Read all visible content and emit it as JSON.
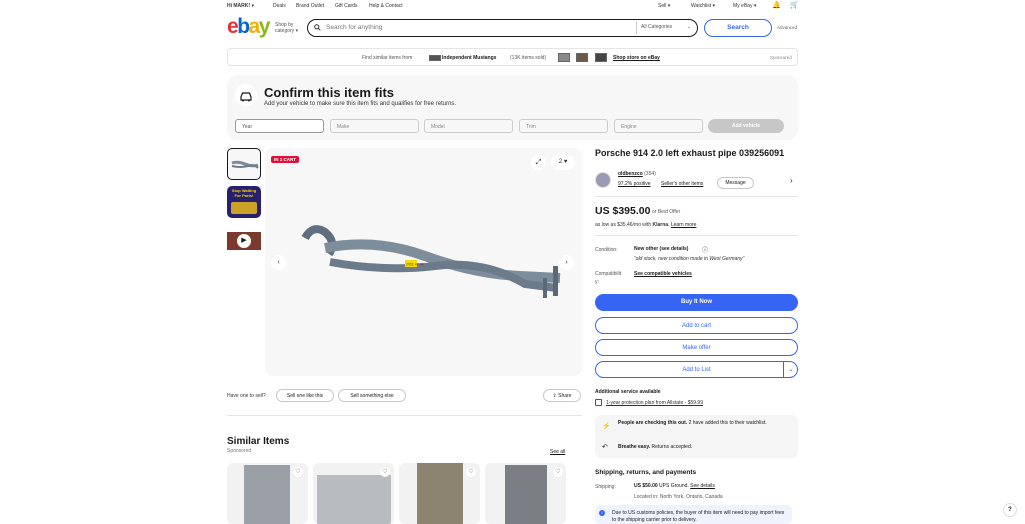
{
  "topbar": {
    "greeting": "Hi MARK!",
    "links": [
      "Deals",
      "Brand Outlet",
      "Gift Cards",
      "Help & Contact"
    ],
    "sell": "Sell",
    "watchlist": "Watchlist",
    "my_ebay": "My eBay"
  },
  "header": {
    "logo": [
      "e",
      "b",
      "a",
      "y"
    ],
    "shop_by": "Shop by",
    "category": "category",
    "search_placeholder": "Search for anything",
    "category_select": "All Categories",
    "search_button": "Search",
    "advanced": "Advanced"
  },
  "banner": {
    "prefix": "Find similar items from",
    "store": "Independent Mustangs",
    "sold": "(13K items sold)",
    "shop_link": "Shop store on eBay",
    "sponsored": "Sponsored"
  },
  "fitment": {
    "title": "Confirm this item fits",
    "subtitle": "Add your vehicle to make sure this item fits and qualifies for free returns.",
    "fields": [
      "Year",
      "Make",
      "Model",
      "Trim",
      "Engine"
    ],
    "button": "Add vehicle"
  },
  "gallery": {
    "badge": "IN 1 CART",
    "watch_count": "2",
    "thumb2_text": "Stop Waiting For Parts!",
    "part_tag": "2051 47 04"
  },
  "sell_prompt": {
    "text": "Have one to sell?",
    "sell_one": "Sell one like this",
    "sell_else": "Sell something else",
    "share": "Share"
  },
  "item": {
    "title": "Porsche 914 2.0 left exhaust pipe 039256091",
    "seller_name": "oldbenzco",
    "seller_count": "(354)",
    "seller_feedback": "97.2% positive",
    "seller_other": "Seller's other items",
    "message": "Message",
    "price": "US $395.00",
    "best_offer": "or Best Offer",
    "klarna_prefix": "as low as $35.46/mo with",
    "klarna": "Klarna.",
    "learn_more": "Learn more",
    "condition_label": "Condition:",
    "condition_value": "New other (see details)",
    "condition_note": "“old stock, new condition made in West Germany”",
    "compat_label_1": "Compatibilit",
    "compat_label_2": "y:",
    "compat_link": "See compatible vehicles",
    "buy_now": "Buy It Now",
    "add_cart": "Add to cart",
    "make_offer": "Make offer",
    "add_list": "Add to List",
    "additional_title": "Additional service available",
    "protection": "1-year protection plan from Allstate - $59.99",
    "checking_bold": "People are checking this out.",
    "checking_rest": "2 have added this to their watchlist.",
    "breathe_bold": "Breathe easy.",
    "breathe_rest": "Returns accepted.",
    "shipping_title": "Shipping, returns, and payments",
    "shipping_label": "Shipping:",
    "shipping_value": "US $50.00",
    "shipping_method": "UPS Ground.",
    "see_details": "See details",
    "location": "Located in: North York, Ontario, Canada",
    "customs": "Due to US customs policies, the buyer of this item will need to pay import fees to the shipping carrier prior to delivery."
  },
  "similar": {
    "title": "Similar Items",
    "sponsored": "Sponsored",
    "see_all": "See all"
  },
  "help": "?"
}
